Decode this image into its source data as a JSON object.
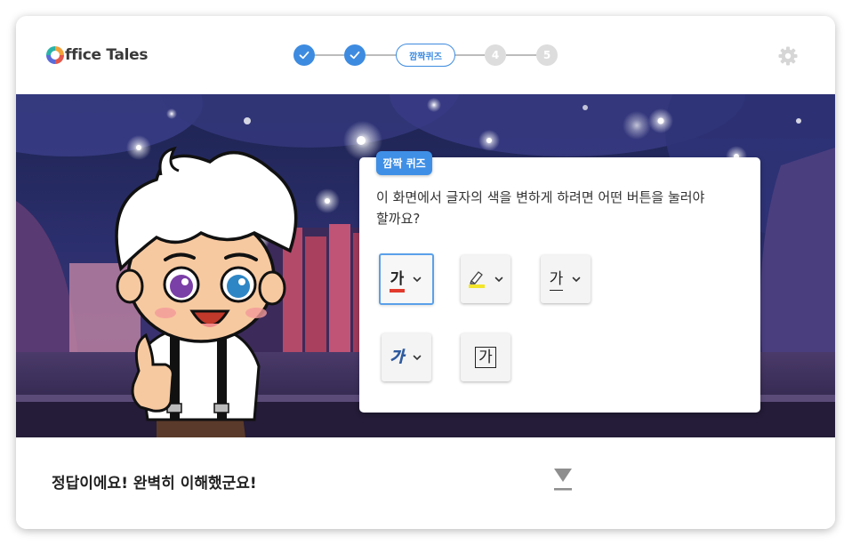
{
  "app": {
    "logo_text": "ffice Tales",
    "logo_icon": "office-tales-o-logo"
  },
  "progress": {
    "steps": [
      {
        "state": "done",
        "icon": "check-icon"
      },
      {
        "state": "done",
        "icon": "check-icon"
      },
      {
        "state": "current",
        "label": "깜짝퀴즈"
      },
      {
        "state": "todo",
        "label": "4"
      },
      {
        "state": "todo",
        "label": "5"
      }
    ]
  },
  "settings_icon": "gear-icon",
  "quiz": {
    "tag": "깜짝 퀴즈",
    "question_line1": "이 화면에서 글자의 색을 변하게 하려면 어떤 버튼을 눌러야",
    "question_line2": "할까요?",
    "options": [
      {
        "glyph": "가",
        "icon": "font-color-icon",
        "underline_color": "#e23b2e",
        "has_dropdown": true,
        "selected": true
      },
      {
        "glyph": "",
        "icon": "highlighter-icon",
        "underline_color": "#f3e52a",
        "has_dropdown": true,
        "selected": false
      },
      {
        "glyph": "가",
        "icon": "underline-icon",
        "has_dropdown": true,
        "selected": false
      },
      {
        "glyph": "가",
        "icon": "text-effect-icon",
        "has_dropdown": true,
        "selected": false
      },
      {
        "glyph": "가",
        "icon": "character-border-icon",
        "has_dropdown": false,
        "selected": false
      }
    ]
  },
  "feedback": {
    "message": "정답이에요! 완벽히 이해했군요!"
  },
  "next_icon": "next-arrow-icon",
  "colors": {
    "accent": "#3d8be0",
    "step_todo": "#dddddd"
  }
}
